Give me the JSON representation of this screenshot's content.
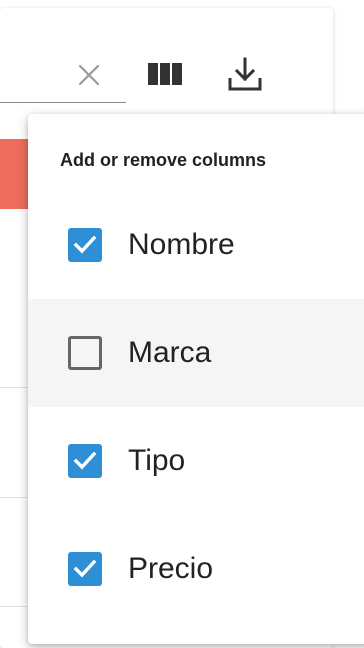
{
  "toolbar": {
    "clear_icon": "close-icon",
    "columns_icon": "view-column-icon",
    "download_icon": "download-icon"
  },
  "columns_popup": {
    "title": "Add or remove columns",
    "options": [
      {
        "label": "Nombre",
        "checked": true
      },
      {
        "label": "Marca",
        "checked": false
      },
      {
        "label": "Tipo",
        "checked": true
      },
      {
        "label": "Precio",
        "checked": true
      }
    ]
  },
  "colors": {
    "accent": "#2f8fd6",
    "header_red": "#ee6e5e",
    "hover_row": "#f5f5f5"
  }
}
